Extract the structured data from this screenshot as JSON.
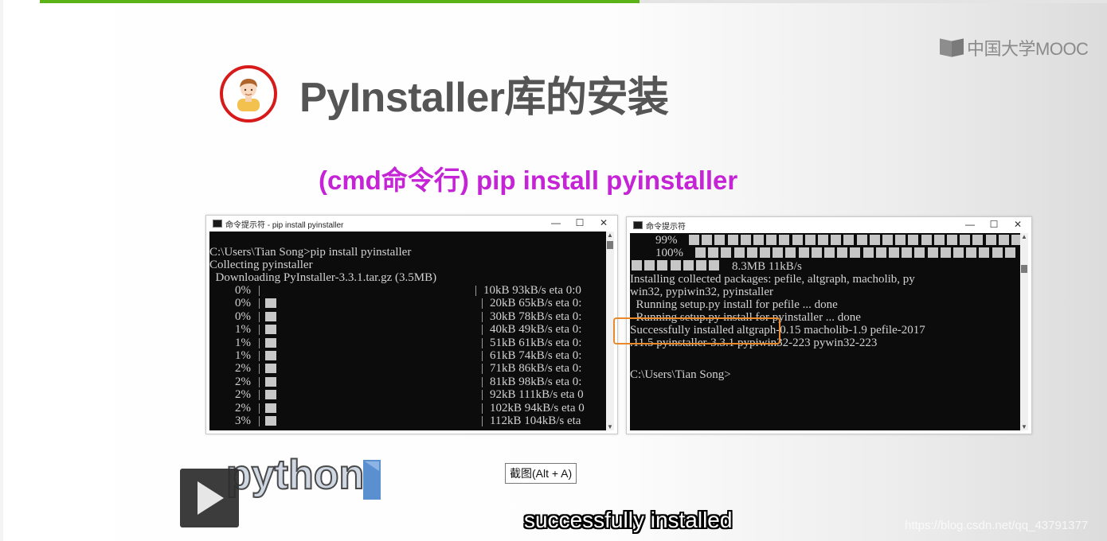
{
  "video": {
    "progress_percent": 56
  },
  "brand": {
    "name": "中国大学MOOC"
  },
  "slide": {
    "title": "PyInstaller库的安装",
    "subtitle": "(cmd命令行)  pip install pyinstaller"
  },
  "cmd_left": {
    "title": "命令提示符 - pip  install pyinstaller",
    "controls": [
      "—",
      "☐",
      "✕"
    ],
    "lines": [
      "C:\\Users\\Tian Song>pip install pyinstaller",
      "Collecting pyinstaller",
      "  Downloading PyInstaller-3.3.1.tar.gz (3.5MB)"
    ],
    "rows": [
      {
        "pct": "0%",
        "stat": "10kB 93kB/s eta 0:0",
        "fill": 0
      },
      {
        "pct": "0%",
        "stat": "20kB 65kB/s eta 0:",
        "fill": 0.01
      },
      {
        "pct": "0%",
        "stat": "30kB 78kB/s eta 0:",
        "fill": 0.01
      },
      {
        "pct": "1%",
        "stat": "40kB 49kB/s eta 0:",
        "fill": 0.01
      },
      {
        "pct": "1%",
        "stat": "51kB 61kB/s eta 0:",
        "fill": 0.015
      },
      {
        "pct": "1%",
        "stat": "61kB 74kB/s eta 0:",
        "fill": 0.015
      },
      {
        "pct": "2%",
        "stat": "71kB 86kB/s eta 0:",
        "fill": 0.02
      },
      {
        "pct": "2%",
        "stat": "81kB 98kB/s eta 0:",
        "fill": 0.02
      },
      {
        "pct": "2%",
        "stat": "92kB 111kB/s eta 0",
        "fill": 0.025
      },
      {
        "pct": "2%",
        "stat": "102kB 94kB/s eta 0",
        "fill": 0.03
      },
      {
        "pct": "3%",
        "stat": "112kB 104kB/s eta",
        "fill": 0.03
      }
    ]
  },
  "cmd_right": {
    "title": "命令提示符",
    "controls": [
      "—",
      "☐",
      "✕"
    ],
    "row_99": "99%",
    "row_100": "100%",
    "size_line": "8.3MB 11kB/s",
    "lines": [
      "Installing collected packages: pefile, altgraph, macholib, py",
      "win32, pypiwin32, pyinstaller",
      "  Running setup.py install for pefile ... done",
      "  Running setup.py install for pyinstaller ... done",
      "Successfully installed altgraph-0.15 macholib-1.9 pefile-2017",
      ".11.5 pyinstaller-3.3.1 pypiwin32-223 pywin32-223",
      "",
      "C:\\Users\\Tian Song>"
    ]
  },
  "tooltip": "截图(Alt + A)",
  "python_logo_text": "python",
  "caption": "successfully installed",
  "watermark": "https://blog.csdn.net/qq_43791377",
  "colors": {
    "accent_green": "#5bb318",
    "title_gray": "#555555",
    "subtitle_magenta": "#c524d6",
    "highlight_orange": "#e8892b",
    "avatar_ring_red": "#d71a1a"
  }
}
